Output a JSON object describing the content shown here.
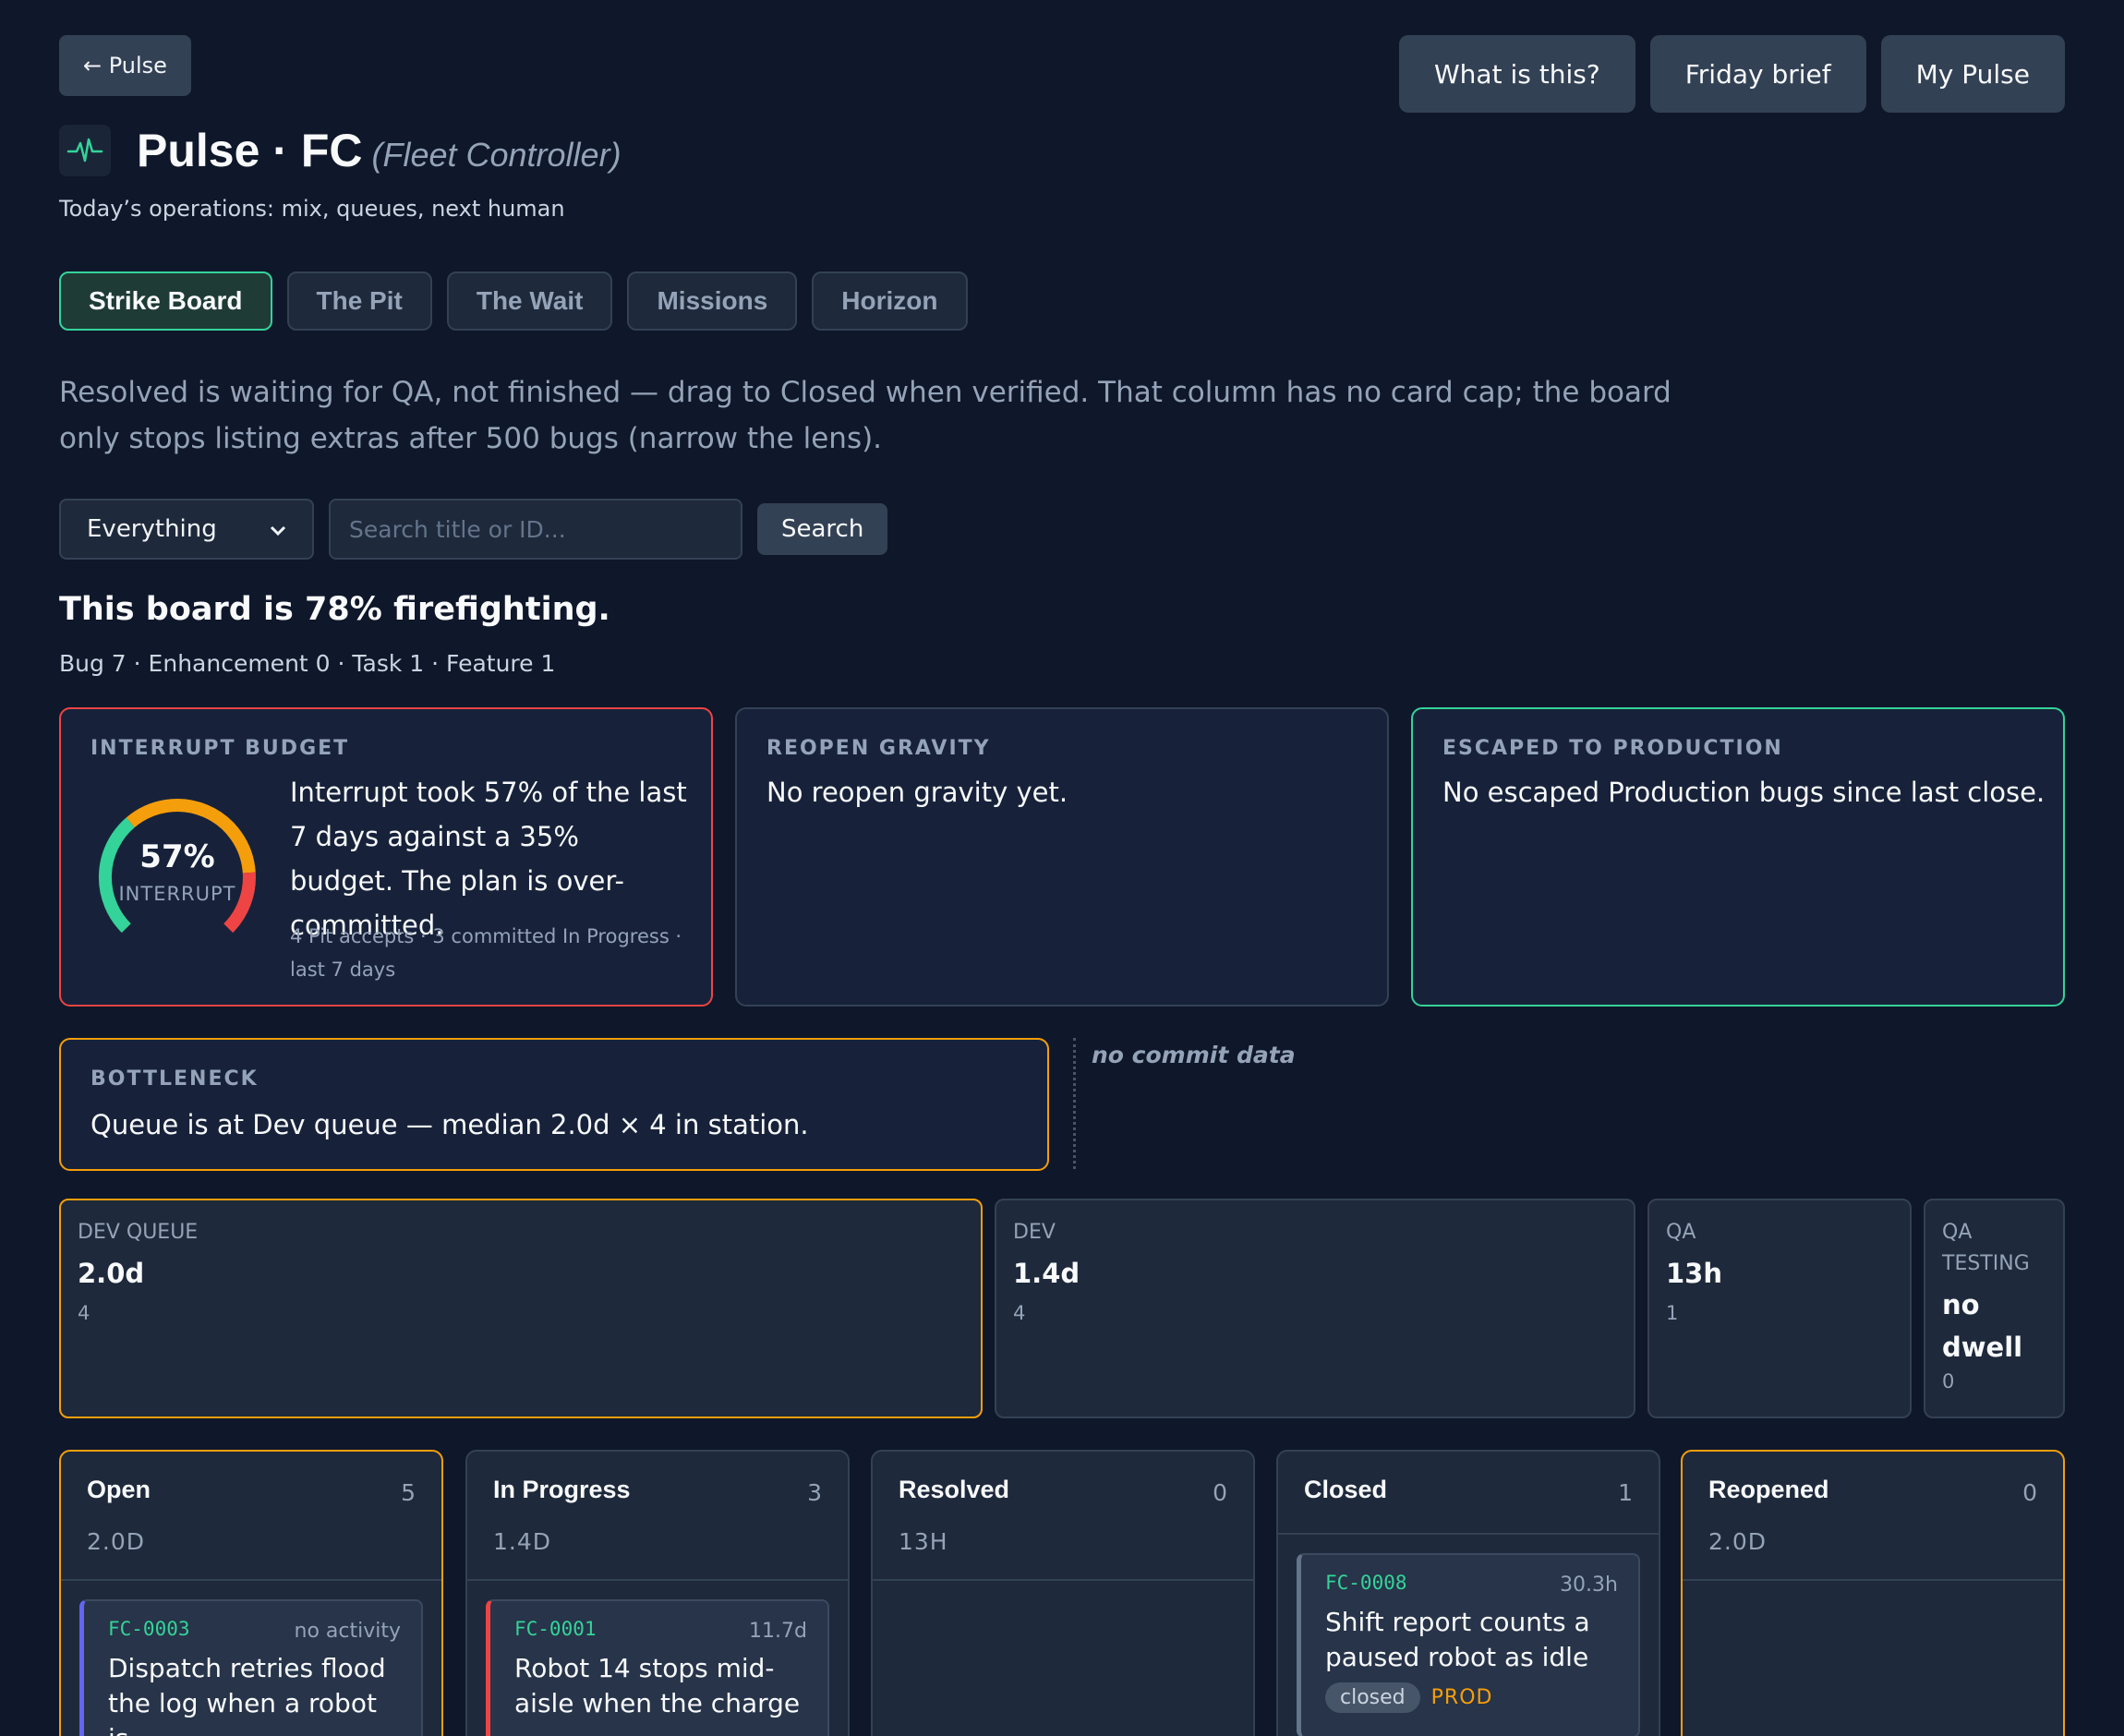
{
  "header": {
    "back_label": "← Pulse",
    "actions": [
      "What is this?",
      "Friday brief",
      "My Pulse"
    ],
    "title": "Pulse · FC",
    "title_sub": "(Fleet Controller)",
    "subtitle": "Today’s operations: mix, queues, next human",
    "logo_icon": "pulse-icon",
    "accent": "#34d399"
  },
  "tabs": [
    {
      "label": "Strike Board",
      "active": true
    },
    {
      "label": "The Pit",
      "active": false
    },
    {
      "label": "The Wait",
      "active": false
    },
    {
      "label": "Missions",
      "active": false
    },
    {
      "label": "Horizon",
      "active": false
    }
  ],
  "hint": "Resolved is waiting for QA, not finished — drag to Closed when verified. That column has no card cap; the board only stops listing extras after 500 bugs (narrow the lens).",
  "filter": {
    "selected": "Everything",
    "search_placeholder": "Search title or ID...",
    "search_label": "Search"
  },
  "summary": {
    "headline": "This board is 78% firefighting.",
    "mix": "Bug 7 · Enhancement 0 · Task 1 · Feature 1"
  },
  "interrupt": {
    "label": "INTERRUPT BUDGET",
    "percent": "57%",
    "gauge_label": "INTERRUPT",
    "value": 57,
    "budget": 35,
    "text": "Interrupt took 57% of the last 7 days against a 35% budget. The plan is over-committed.",
    "footnote": "4 Pit accepts · 3 committed In Progress · last 7 days",
    "border_color": "#ef4444"
  },
  "reopen": {
    "label": "REOPEN GRAVITY",
    "text": "No reopen gravity yet."
  },
  "escaped": {
    "label": "ESCAPED TO PRODUCTION",
    "text": "No escaped Production bugs since last close.",
    "border_color": "#34d399"
  },
  "bottleneck": {
    "label": "BOTTLENECK",
    "text": "Queue is at Dev queue — median 2.0d × 4 in station.",
    "aside": "no commit data",
    "border_color": "#f59e0b"
  },
  "stations": [
    {
      "name": "DEV QUEUE",
      "dwell": "2.0d",
      "count": "4"
    },
    {
      "name": "DEV",
      "dwell": "1.4d",
      "count": "4"
    },
    {
      "name": "QA",
      "dwell": "13h",
      "count": "1"
    },
    {
      "name": "QA TESTING",
      "dwell": "no dwell",
      "count": "0"
    }
  ],
  "columns": [
    {
      "name": "Open",
      "count": "5",
      "dwell": "2.0D",
      "ticket": {
        "id": "FC-0003",
        "age": "no activity",
        "title": "Dispatch retries flood the log when a robot is",
        "accent": "#6366f1"
      }
    },
    {
      "name": "In Progress",
      "count": "3",
      "dwell": "1.4D",
      "ticket": {
        "id": "FC-0001",
        "age": "11.7d",
        "title": "Robot 14 stops mid-aisle when the charge",
        "accent": "#ef4444"
      }
    },
    {
      "name": "Resolved",
      "count": "0",
      "dwell": "13H"
    },
    {
      "name": "Closed",
      "count": "1",
      "dwell": "",
      "ticket": {
        "id": "FC-0008",
        "age": "30.3h",
        "title": "Shift report counts a paused robot as idle",
        "accent": "#64748b",
        "status": "closed",
        "env": "PROD"
      }
    },
    {
      "name": "Reopened",
      "count": "0",
      "dwell": "2.0D"
    }
  ]
}
